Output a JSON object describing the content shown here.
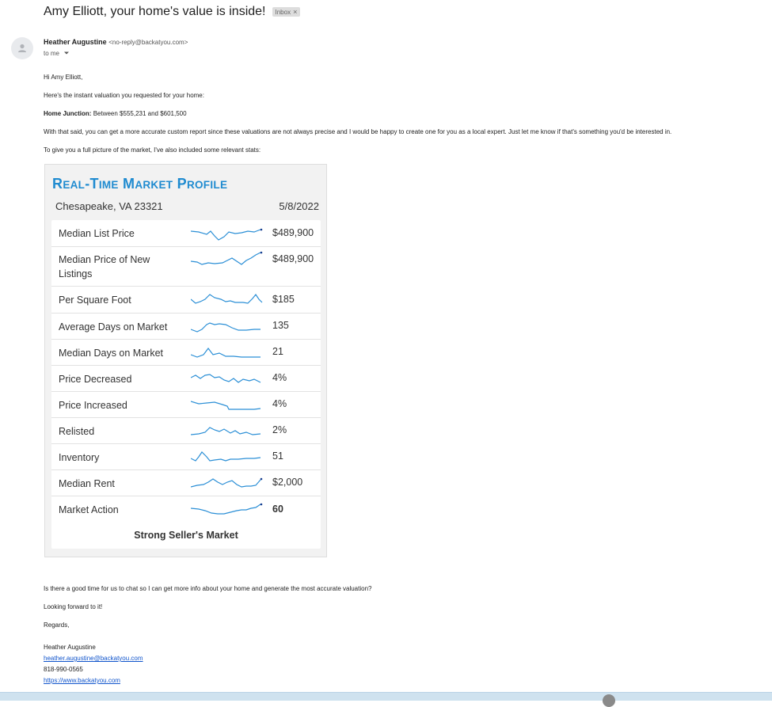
{
  "email": {
    "subject": "Amy Elliott, your home's value is inside!",
    "label": "Inbox",
    "label_close": "×",
    "sender_name": "Heather Augustine",
    "sender_email": "<no-reply@backatyou.com>",
    "to_me": "to me",
    "greeting": "Hi Amy Elliott,",
    "intro": "Here's the instant valuation you requested for your home:",
    "valuation_label": "Home Junction:",
    "valuation_text": "Between $555,231 and $601,500",
    "paragraph1": "With that said, you can get a more accurate custom report since these valuations are not always precise and I would be happy to create one for you as a local expert. Just let me know if that's something you'd be interested in.",
    "paragraph2": "To give you a full picture of the market, I've also included some relevant stats:",
    "question": "Is there a good time for us to chat so I can get more info about your home and generate the most accurate valuation?",
    "closing1": "Looking forward to it!",
    "closing2": "Regards,",
    "sig_name": "Heather Augustine",
    "sig_email": "heather.augustine@backatyou.com",
    "sig_phone": "818-990-0565",
    "sig_url": "https://www.backatyou.com"
  },
  "market": {
    "title": "Real-Time Market Profile",
    "location": "Chesapeake, VA 23321",
    "date": "5/8/2022",
    "verdict": "Strong Seller's Market",
    "rows": [
      {
        "label": "Median List Price",
        "value": "$489,900"
      },
      {
        "label": "Median Price of New Listings",
        "value": "$489,900"
      },
      {
        "label": "Per Square Foot",
        "value": "$185"
      },
      {
        "label": "Average Days on Market",
        "value": "135"
      },
      {
        "label": "Median Days on Market",
        "value": "21"
      },
      {
        "label": "Price Decreased",
        "value": "4%"
      },
      {
        "label": "Price Increased",
        "value": "4%"
      },
      {
        "label": "Relisted",
        "value": "2%"
      },
      {
        "label": "Inventory",
        "value": "51"
      },
      {
        "label": "Median Rent",
        "value": "$2,000"
      },
      {
        "label": "Market Action",
        "value": "60"
      }
    ]
  },
  "colors": {
    "accent": "#1f8bd0",
    "sparkline": "#2b8fd6",
    "link": "#1155cc"
  },
  "icons": {
    "avatar": "person-icon",
    "dropdown": "chevron-down-icon"
  }
}
